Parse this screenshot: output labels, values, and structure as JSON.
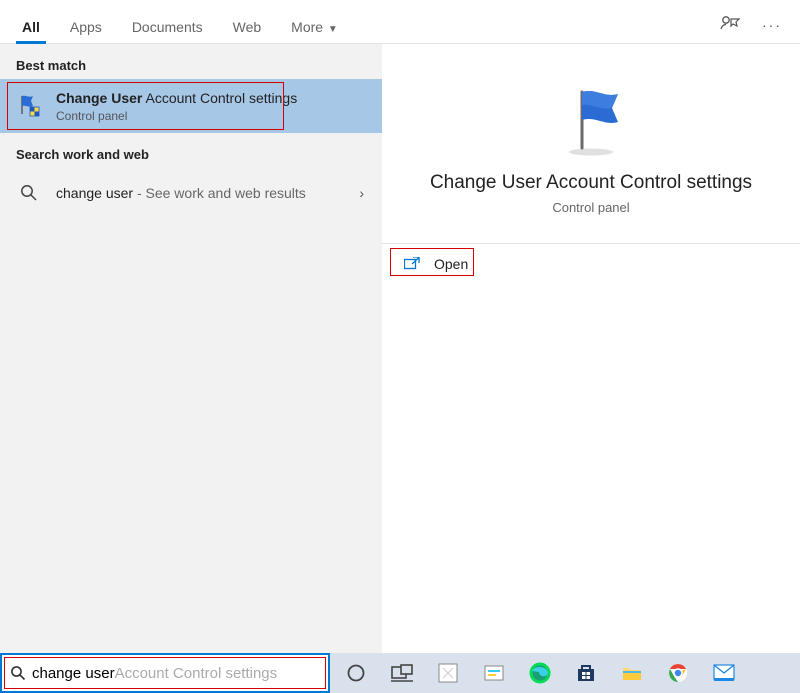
{
  "tabs": {
    "all": "All",
    "apps": "Apps",
    "documents": "Documents",
    "web": "Web",
    "more": "More"
  },
  "sections": {
    "best_match": "Best match",
    "work_web": "Search work and web"
  },
  "result": {
    "title_bold": "Change User",
    "title_rest": " Account Control settings",
    "sub": "Control panel"
  },
  "web_result": {
    "query": "change user",
    "suffix": " - See work and web results"
  },
  "detail": {
    "title": "Change User Account Control settings",
    "sub": "Control panel",
    "open": "Open"
  },
  "search": {
    "query": "change user",
    "suggestion": " Account Control settings"
  }
}
